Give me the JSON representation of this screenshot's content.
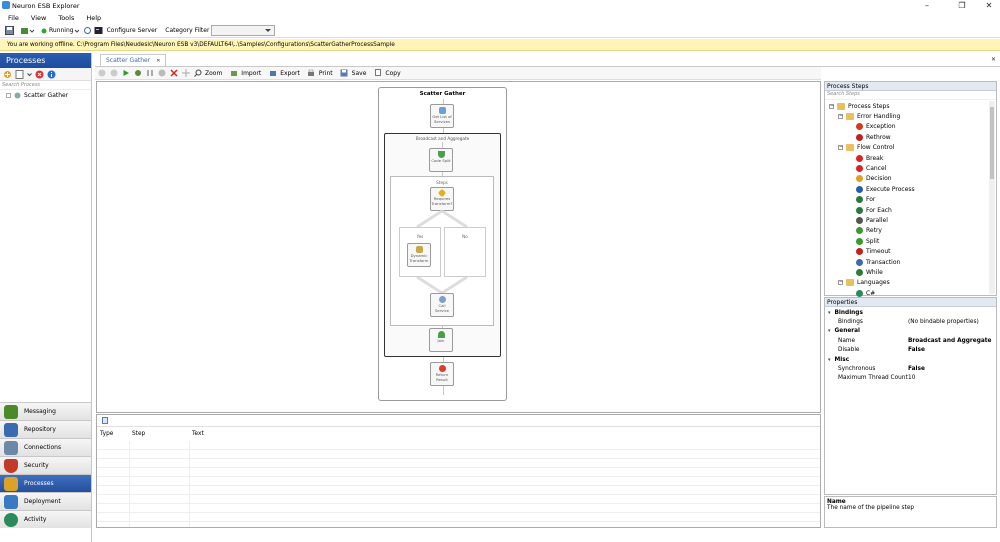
{
  "window": {
    "title": "Neuron ESB Explorer",
    "minimize": "–",
    "restore": "❐",
    "close": "✕"
  },
  "menu": [
    "File",
    "View",
    "Tools",
    "Help"
  ],
  "toolbar": {
    "status": "Running",
    "configure_server": "Configure Server",
    "category_filter": "Category Filter",
    "category_value": ""
  },
  "banner": {
    "text": "You are working offline. C:\\Program Files\\Neudesic\\Neuron ESB v3\\DEFAULT64\\..\\Samples\\Configurations\\ScatterGatherProcessSample"
  },
  "left_panel": {
    "title": "Processes",
    "search_placeholder": "Search Process",
    "tree": [
      {
        "label": "Scatter Gather"
      }
    ],
    "nav": [
      {
        "label": "Messaging",
        "color": "#4a8a2a"
      },
      {
        "label": "Repository",
        "color": "#3a6ab0"
      },
      {
        "label": "Connections",
        "color": "#6a8aa8"
      },
      {
        "label": "Security",
        "color": "#c23a2a"
      },
      {
        "label": "Processes",
        "color": "#d9a32a"
      },
      {
        "label": "Deployment",
        "color": "#3a7ac0"
      },
      {
        "label": "Activity",
        "color": "#2a8a5a"
      }
    ]
  },
  "doc": {
    "tab": "Scatter Gather",
    "tab_close": "✕",
    "pane_close": "✕",
    "toolbar": {
      "zoom": "Zoom",
      "import": "Import",
      "export": "Export",
      "print": "Print",
      "save": "Save",
      "copy": "Copy"
    }
  },
  "designer": {
    "title": "Scatter Gather",
    "broadcast": "Broadcast and Aggregate",
    "steps_label": "Steps",
    "yes": "Yes",
    "no": "No",
    "step_labels": {
      "get_list": "Get List of Services",
      "code_split": "Code Split",
      "requires": "Requires Transform?",
      "dynamic": "Dynamic Transform",
      "call_service": "Call Service",
      "join": "Join",
      "return_result": "Return Result"
    }
  },
  "output": {
    "columns": [
      "Type",
      "Step",
      "Text"
    ]
  },
  "process_steps": {
    "title": "Process Steps",
    "search_placeholder": "Search Steps",
    "root": "Process Steps",
    "groups": [
      {
        "label": "Error Handling",
        "items": [
          {
            "label": "Exception",
            "color": "#d23a1a"
          },
          {
            "label": "Rethrow",
            "color": "#c02020"
          }
        ]
      },
      {
        "label": "Flow Control",
        "items": [
          {
            "label": "Break",
            "color": "#d22"
          },
          {
            "label": "Cancel",
            "color": "#d22"
          },
          {
            "label": "Decision",
            "color": "#e0a020"
          },
          {
            "label": "Execute Process",
            "color": "#2a5aa8"
          },
          {
            "label": "For",
            "color": "#2a7a3a"
          },
          {
            "label": "For Each",
            "color": "#2a7a3a"
          },
          {
            "label": "Parallel",
            "color": "#555"
          },
          {
            "label": "Retry",
            "color": "#3a9a2a"
          },
          {
            "label": "Split",
            "color": "#3a9a2a"
          },
          {
            "label": "Timeout",
            "color": "#c02020"
          },
          {
            "label": "Transaction",
            "color": "#3a6ab0"
          },
          {
            "label": "While",
            "color": "#2a7a3a"
          }
        ]
      },
      {
        "label": "Languages",
        "items": [
          {
            "label": "C#",
            "color": "#2a8a5a"
          }
        ]
      }
    ]
  },
  "properties": {
    "title": "Properties",
    "categories": [
      {
        "name": "Bindings",
        "rows": [
          {
            "name": "Bindings",
            "value": "(No bindable properties)",
            "bold": false
          }
        ]
      },
      {
        "name": "General",
        "rows": [
          {
            "name": "Name",
            "value": "Broadcast and Aggregate",
            "bold": true
          },
          {
            "name": "Disable",
            "value": "False",
            "bold": true
          }
        ]
      },
      {
        "name": "Misc",
        "rows": [
          {
            "name": "Synchronous",
            "value": "False",
            "bold": true
          },
          {
            "name": "Maximum Thread Count",
            "value": "10",
            "bold": false
          }
        ]
      }
    ]
  },
  "description": {
    "title": "Name",
    "text": "The name of the pipeline step"
  }
}
